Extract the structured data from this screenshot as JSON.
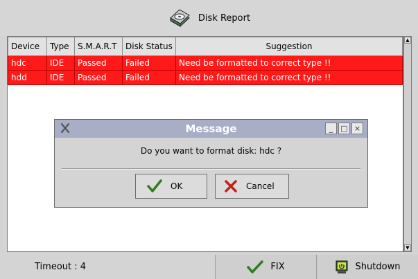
{
  "header": {
    "title": "Disk Report",
    "icon": "disk-icon"
  },
  "table": {
    "columns": [
      "Device",
      "Type",
      "S.M.A.R.T",
      "Disk Status",
      "Suggestion"
    ],
    "rows": [
      [
        "hdc",
        "IDE",
        "Passed",
        "Failed",
        "Need be formatted to correct type !!"
      ],
      [
        "hdd",
        "IDE",
        "Passed",
        "Failed",
        "Need be formatted to correct type !!"
      ]
    ],
    "row_color": "#ff1a1a"
  },
  "dialog": {
    "title": "Message",
    "message": "Do you want to format disk: hdc ?",
    "ok_label": "OK",
    "cancel_label": "Cancel",
    "title_color": "#a7aec5"
  },
  "statusbar": {
    "timeout_label": "Timeout : 4",
    "fix_label": "FIX",
    "shutdown_label": "Shutdown"
  }
}
